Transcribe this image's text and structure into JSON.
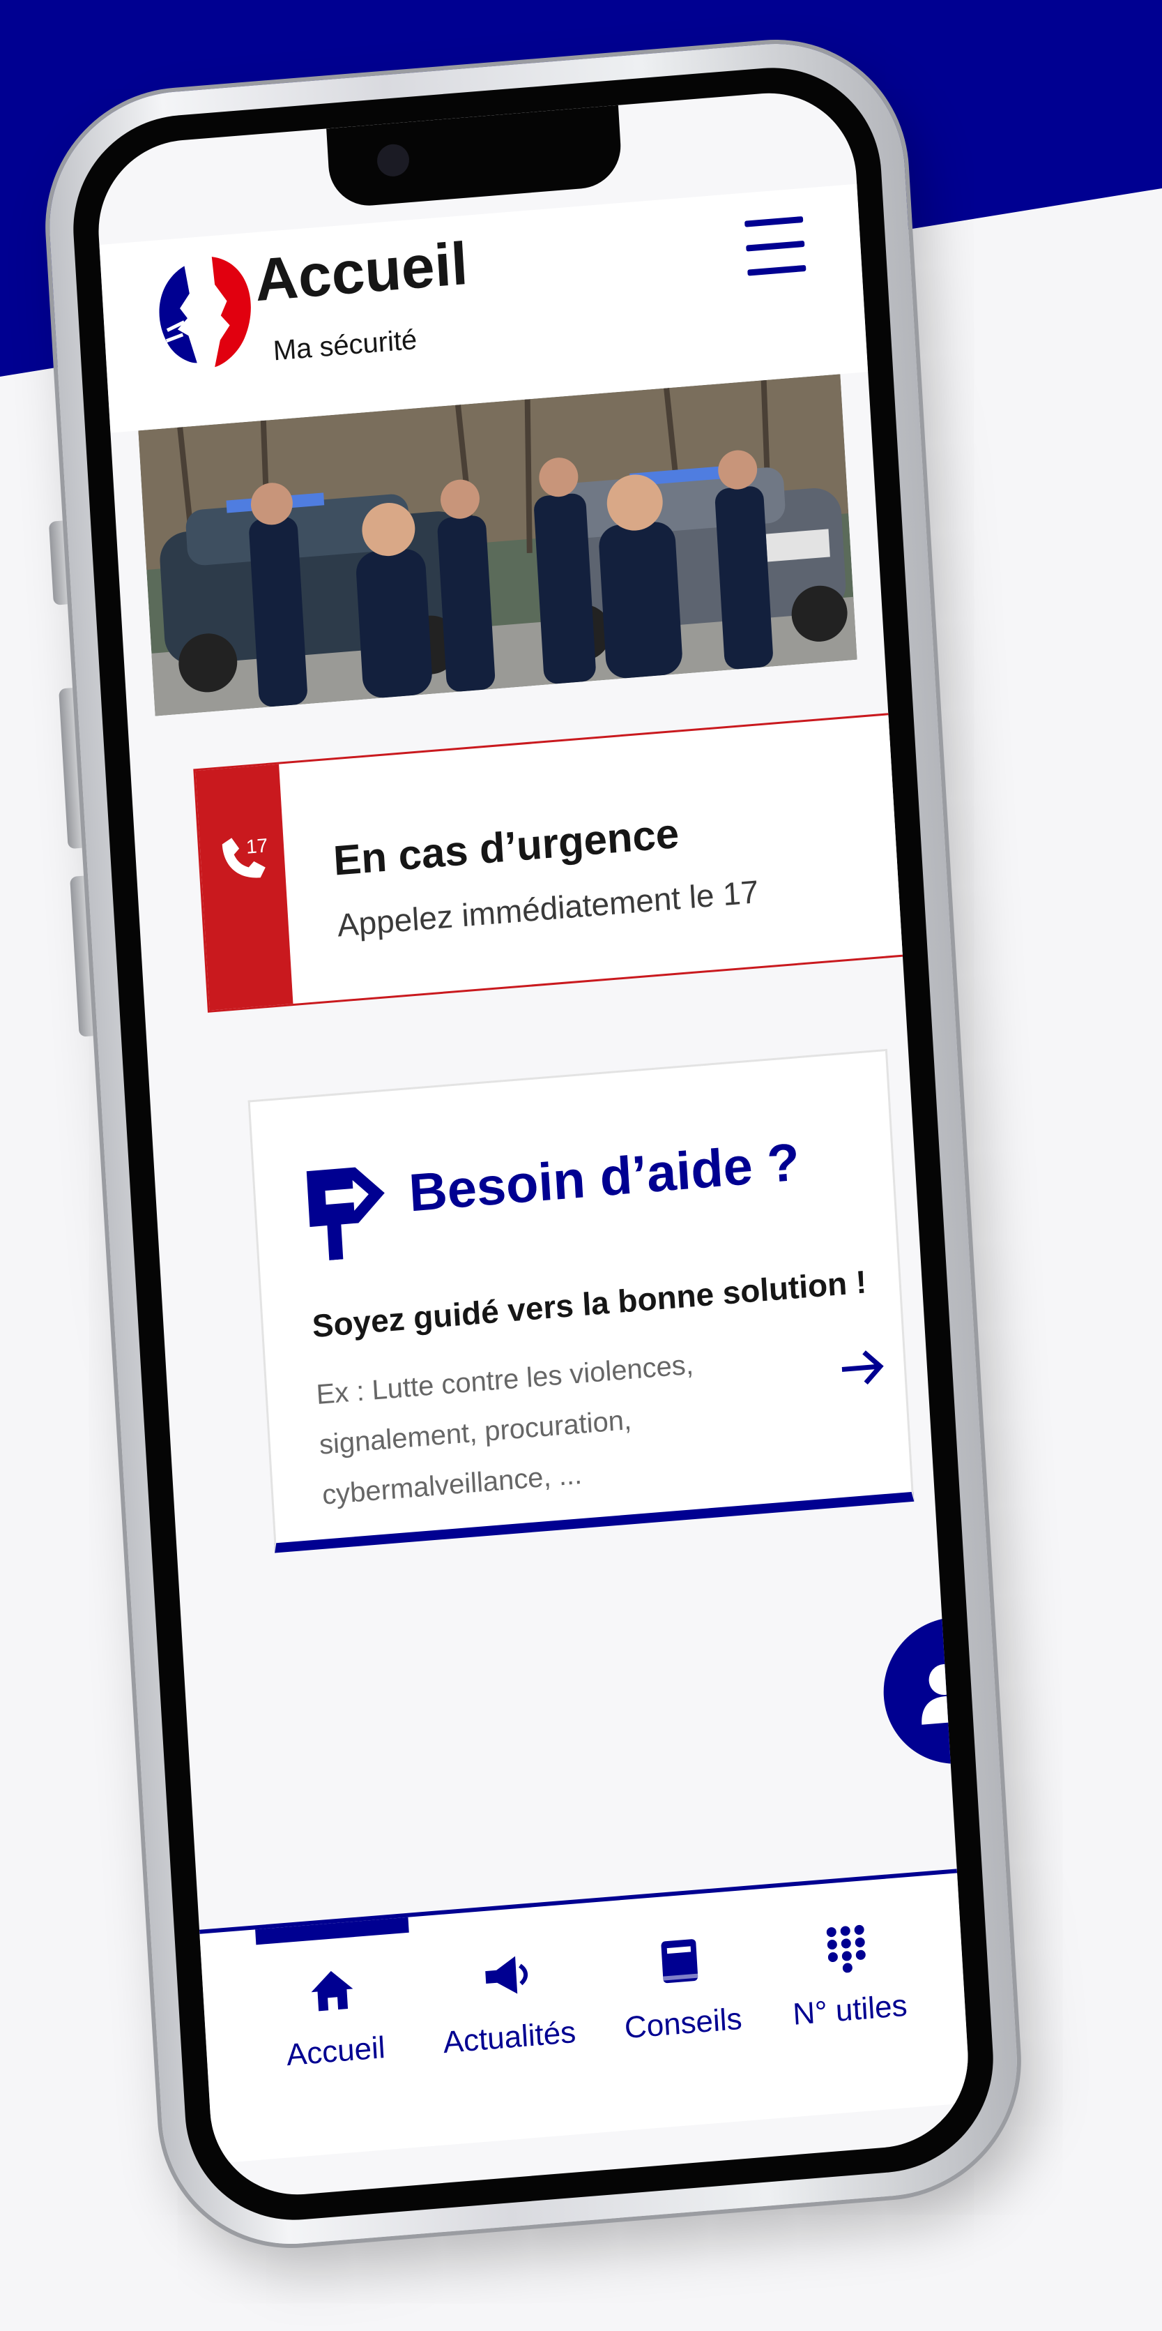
{
  "header": {
    "title": "Accueil",
    "subtitle": "Ma sécurité",
    "menu_icon": "hamburger-menu-icon"
  },
  "urgence": {
    "badge": "17",
    "title": "En cas d’urgence",
    "text": "Appelez immédiatement le 17",
    "icon": "phone-icon"
  },
  "aide": {
    "title": "Besoin d’aide ?",
    "subtitle": "Soyez guidé vers la bonne solution !",
    "example": "Ex : Lutte contre les violences, signalement, procuration, cybermalveillance, ...",
    "icon": "signpost-icon",
    "arrow_icon": "arrow-right-icon"
  },
  "fab": {
    "icon": "contact-card-icon"
  },
  "nav": {
    "items": [
      {
        "label": "Accueil",
        "icon": "home-icon"
      },
      {
        "label": "Actualités",
        "icon": "megaphone-icon"
      },
      {
        "label": "Conseils",
        "icon": "book-icon"
      },
      {
        "label": "N° utiles",
        "icon": "keypad-icon"
      }
    ],
    "active": "Accueil"
  },
  "colors": {
    "primary_blue": "#000091",
    "alert_red": "#c9191e",
    "background": "#f6f6f8"
  }
}
